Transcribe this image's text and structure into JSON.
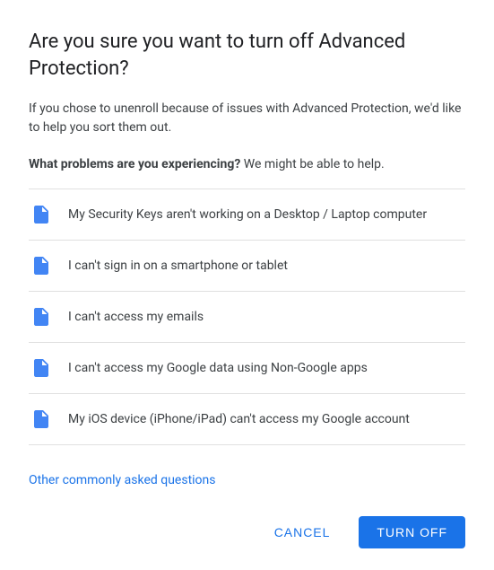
{
  "dialog": {
    "title": "Are you sure you want to turn off Advanced Protection?",
    "subtitle": "If you chose to unenroll because of issues with Advanced Protection, we'd like to help you sort them out.",
    "problems_heading_bold": "What problems are you experiencing?",
    "problems_heading_rest": " We might be able to help.",
    "list_items": [
      {
        "id": "item-1",
        "text": "My Security Keys aren't working on a Desktop / Laptop computer"
      },
      {
        "id": "item-2",
        "text": "I can't sign in on a smartphone or tablet"
      },
      {
        "id": "item-3",
        "text": "I can't access my emails"
      },
      {
        "id": "item-4",
        "text": "I can't access my Google data using Non-Google apps"
      },
      {
        "id": "item-5",
        "text": "My iOS device (iPhone/iPad) can't access my Google account"
      }
    ],
    "other_questions_link": "Other commonly asked questions",
    "footer": {
      "cancel_label": "CANCEL",
      "turn_off_label": "TURN OFF"
    }
  }
}
